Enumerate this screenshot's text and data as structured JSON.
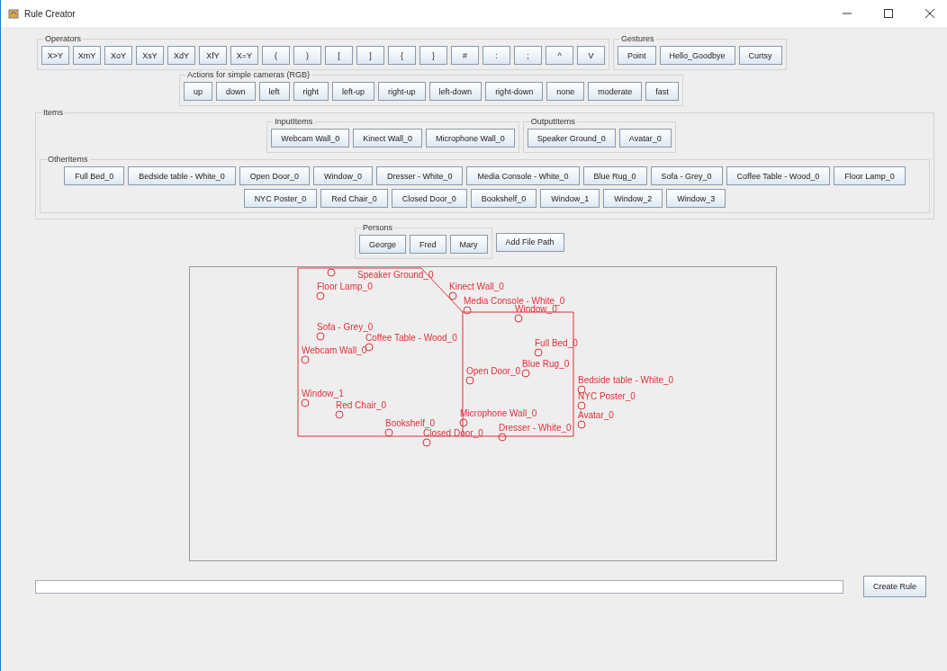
{
  "window": {
    "title": "Rule Creator"
  },
  "operators": {
    "title": "Operators",
    "buttons": [
      "X>Y",
      "XmY",
      "XoY",
      "XsY",
      "XdY",
      "XfY",
      "X=Y",
      "(",
      ")",
      "[",
      "]",
      "{",
      "}",
      "#",
      ":",
      ";",
      "^",
      "V"
    ]
  },
  "gestures": {
    "title": "Gestures",
    "buttons": [
      "Point",
      "Hello_Goodbye",
      "Curtsy"
    ]
  },
  "actions": {
    "title": "Actions for simple cameras (RGB)",
    "buttons": [
      "up",
      "down",
      "left",
      "right",
      "left-up",
      "right-up",
      "left-down",
      "right-down",
      "none",
      "moderate",
      "fast"
    ]
  },
  "items": {
    "title": "Items",
    "input_items": {
      "title": "InputItems",
      "buttons": [
        "Webcam Wall_0",
        "Kinect Wall_0",
        "Microphone Wall_0"
      ]
    },
    "output_items": {
      "title": "OutputItems",
      "buttons": [
        "Speaker Ground_0",
        "Avatar_0"
      ]
    },
    "other_items": {
      "title": "OtherItems",
      "buttons": [
        "Full Bed_0",
        "Bedside table - White_0",
        "Open Door_0",
        "Window_0",
        "Dresser - White_0",
        "Media Console - White_0",
        "Blue Rug_0",
        "Sofa - Grey_0",
        "Coffee Table - Wood_0",
        "Floor Lamp_0",
        "NYC Poster_0",
        "Red Chair_0",
        "Closed Door_0",
        "Bookshelf_0",
        "Window_1",
        "Window_2",
        "Window_3"
      ]
    }
  },
  "persons": {
    "title": "Persons",
    "buttons": [
      "George",
      "Fred",
      "Mary"
    ]
  },
  "add_file_path_button": "Add File Path",
  "map": {
    "nodes": [
      "Speaker Ground_0",
      "Floor Lamp_0",
      "Kinect Wall_0",
      "Media Console - White_0",
      "Window_0",
      "Sofa - Grey_0",
      "Coffee Table - Wood_0",
      "Webcam Wall_0",
      "Full Bed_0",
      "Blue Rug_0",
      "Open Door_0",
      "Bedside table - White_0",
      "Window_1",
      "NYC Poster_0",
      "Red Chair_0",
      "Avatar_0",
      "Microphone Wall_0",
      "Dresser - White_0",
      "Bookshelf_0",
      "Closed Door_0"
    ]
  },
  "create_rule_button": "Create Rule"
}
